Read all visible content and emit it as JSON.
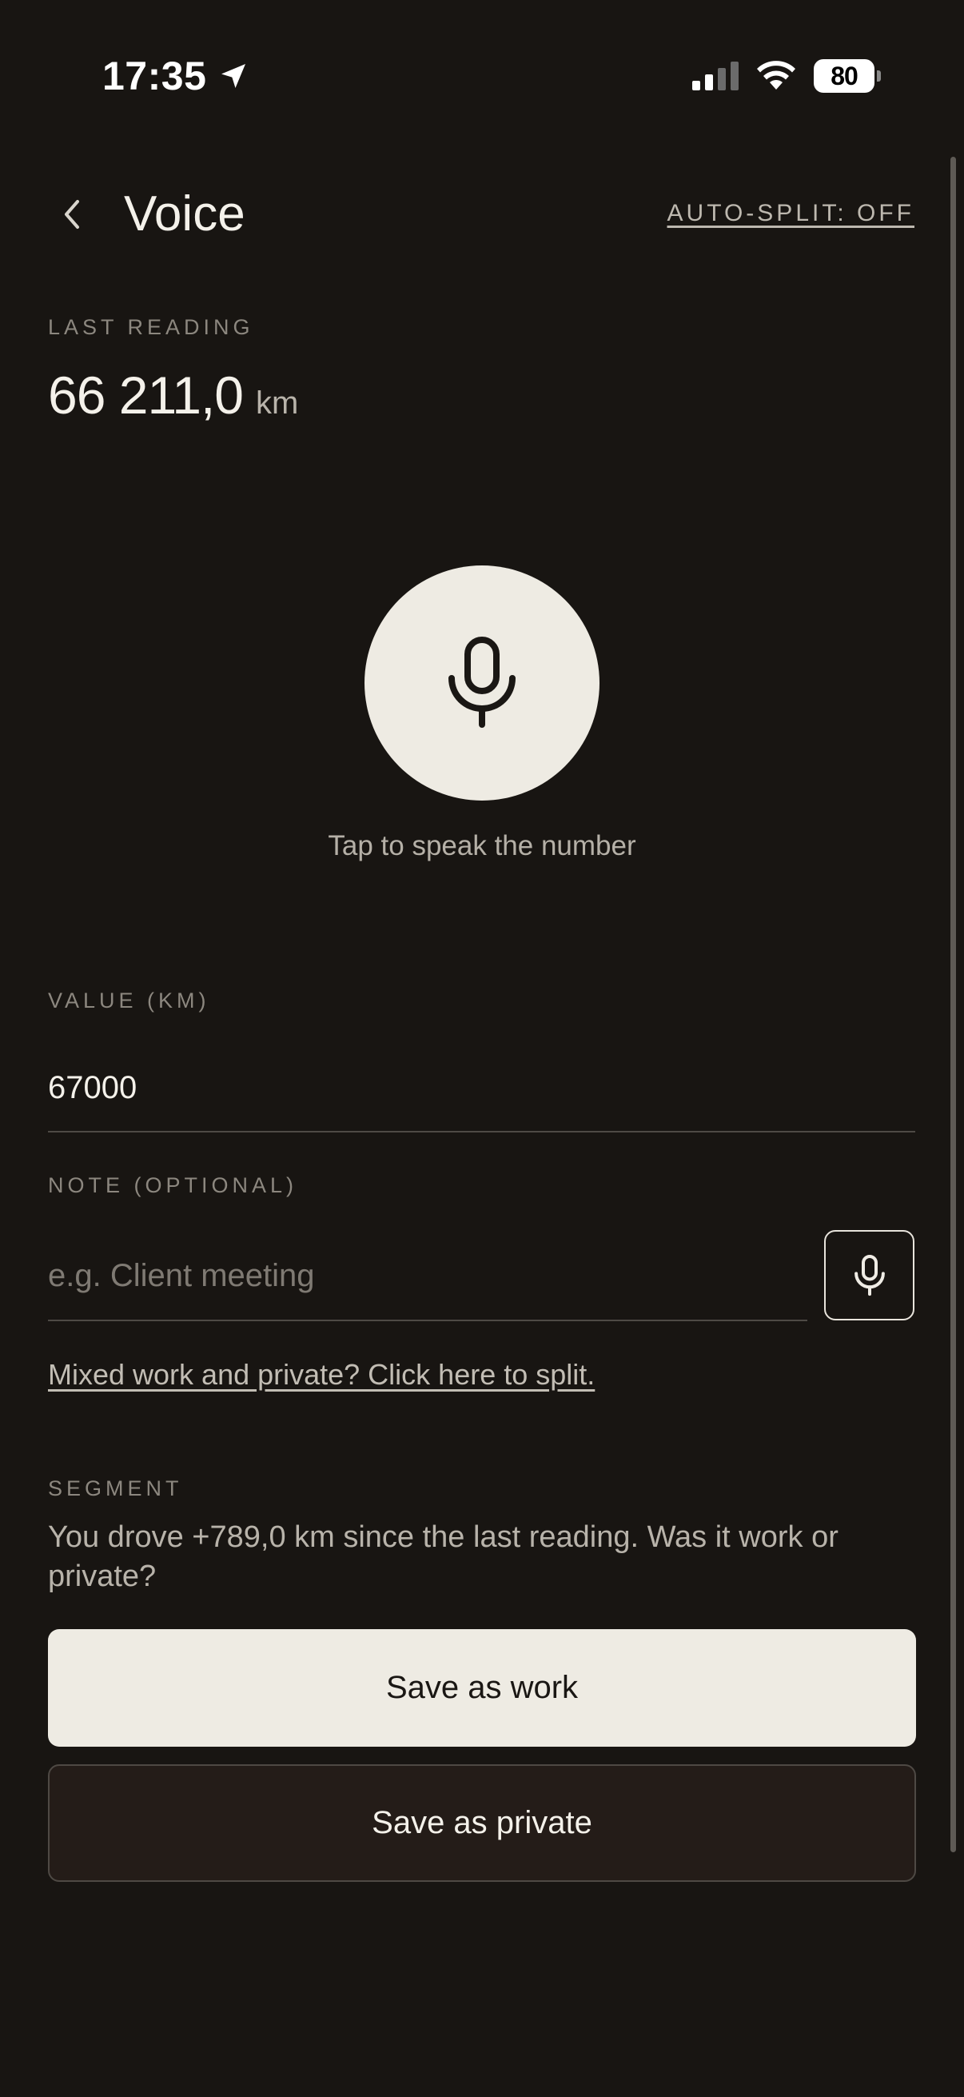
{
  "status_bar": {
    "time": "17:35",
    "battery": "80"
  },
  "header": {
    "title": "Voice",
    "auto_split": "AUTO-SPLIT: OFF"
  },
  "last_reading": {
    "label": "LAST READING",
    "value": "66 211,0",
    "unit": "km"
  },
  "voice": {
    "hint": "Tap to speak the number"
  },
  "value_field": {
    "label": "VALUE (KM)",
    "value": "67000"
  },
  "note_field": {
    "label": "NOTE (OPTIONAL)",
    "placeholder": "e.g. Client meeting",
    "value": ""
  },
  "split_link": "Mixed work and private? Click here to split.",
  "segment": {
    "label": "SEGMENT",
    "text": "You drove +789,0 km since the last reading. Was it work or private?"
  },
  "actions": {
    "save_work": "Save as work",
    "save_private": "Save as private"
  },
  "colors": {
    "background": "#181512",
    "primary_button": "#EEEBE3",
    "secondary_button": "#241C18",
    "muted_text": "#8C877F"
  }
}
